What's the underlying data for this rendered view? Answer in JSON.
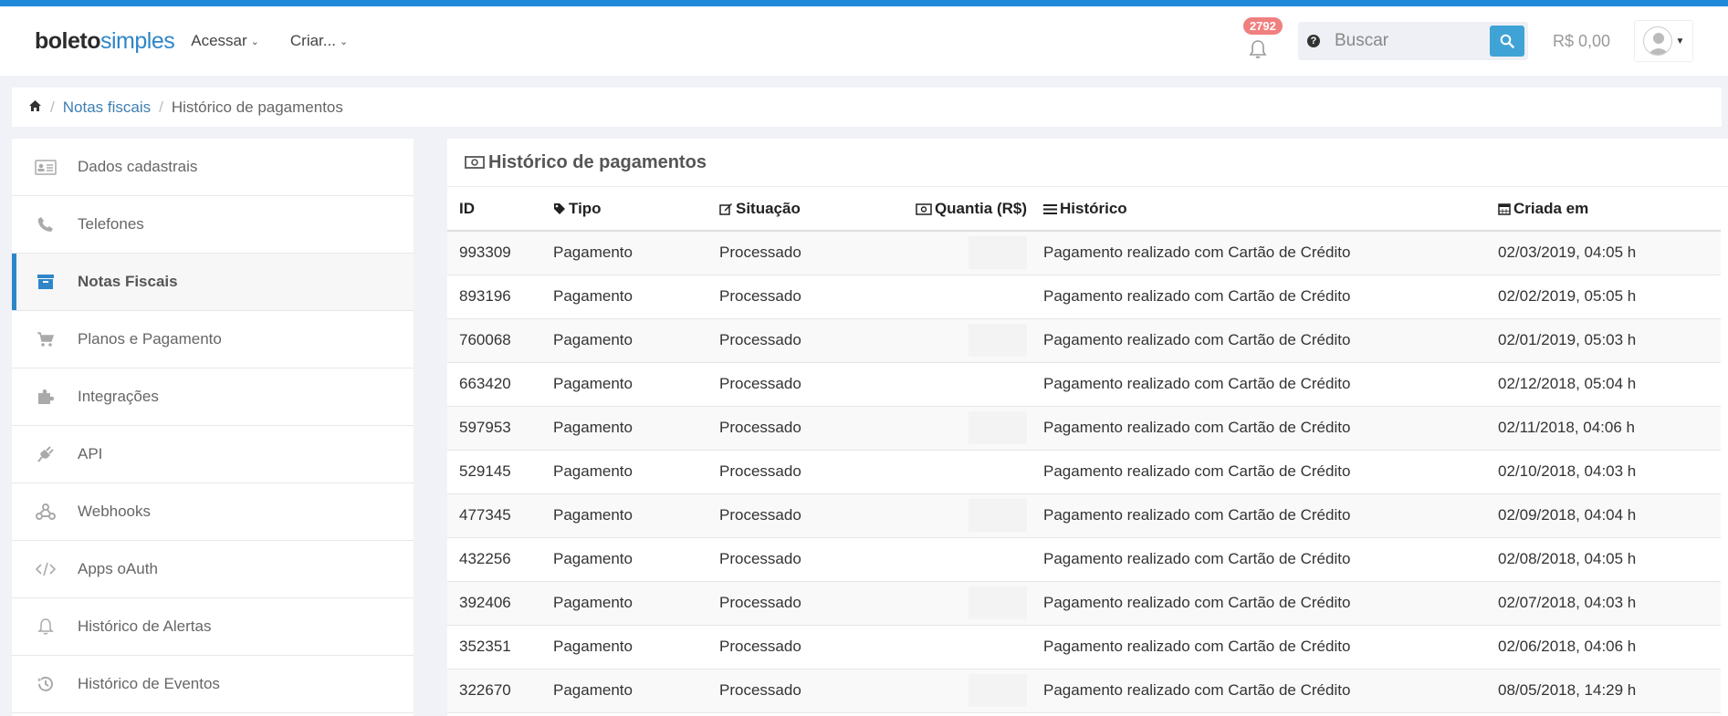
{
  "logo": {
    "part1": "boleto",
    "part2": "simples"
  },
  "nav": {
    "acessar": "Acessar",
    "criar": "Criar..."
  },
  "notifications": {
    "count": "2792"
  },
  "search": {
    "placeholder": "Buscar"
  },
  "balance": "R$ 0,00",
  "breadcrumb": {
    "notas": "Notas fiscais",
    "current": "Histórico de pagamentos"
  },
  "sidebar": {
    "items": [
      {
        "label": "Dados cadastrais",
        "icon": "id-card-icon"
      },
      {
        "label": "Telefones",
        "icon": "phone-icon"
      },
      {
        "label": "Notas Fiscais",
        "icon": "archive-icon"
      },
      {
        "label": "Planos e Pagamento",
        "icon": "cart-icon"
      },
      {
        "label": "Integrações",
        "icon": "puzzle-icon"
      },
      {
        "label": "API",
        "icon": "plug-icon"
      },
      {
        "label": "Webhooks",
        "icon": "webhook-icon"
      },
      {
        "label": "Apps oAuth",
        "icon": "code-icon"
      },
      {
        "label": "Histórico de Alertas",
        "icon": "bell-icon"
      },
      {
        "label": "Histórico de Eventos",
        "icon": "history-icon"
      }
    ]
  },
  "panel": {
    "title": "Histórico de pagamentos"
  },
  "table": {
    "headers": {
      "id": "ID",
      "tipo": "Tipo",
      "situacao": "Situação",
      "quantia": "Quantia (R$)",
      "historico": "Histórico",
      "criada": "Criada em"
    },
    "rows": [
      {
        "id": "993309",
        "tipo": "Pagamento",
        "situacao": "Processado",
        "historico": "Pagamento realizado com Cartão de Crédito",
        "criada": "02/03/2019, 04:05 h"
      },
      {
        "id": "893196",
        "tipo": "Pagamento",
        "situacao": "Processado",
        "historico": "Pagamento realizado com Cartão de Crédito",
        "criada": "02/02/2019, 05:05 h"
      },
      {
        "id": "760068",
        "tipo": "Pagamento",
        "situacao": "Processado",
        "historico": "Pagamento realizado com Cartão de Crédito",
        "criada": "02/01/2019, 05:03 h"
      },
      {
        "id": "663420",
        "tipo": "Pagamento",
        "situacao": "Processado",
        "historico": "Pagamento realizado com Cartão de Crédito",
        "criada": "02/12/2018, 05:04 h"
      },
      {
        "id": "597953",
        "tipo": "Pagamento",
        "situacao": "Processado",
        "historico": "Pagamento realizado com Cartão de Crédito",
        "criada": "02/11/2018, 04:06 h"
      },
      {
        "id": "529145",
        "tipo": "Pagamento",
        "situacao": "Processado",
        "historico": "Pagamento realizado com Cartão de Crédito",
        "criada": "02/10/2018, 04:03 h"
      },
      {
        "id": "477345",
        "tipo": "Pagamento",
        "situacao": "Processado",
        "historico": "Pagamento realizado com Cartão de Crédito",
        "criada": "02/09/2018, 04:04 h"
      },
      {
        "id": "432256",
        "tipo": "Pagamento",
        "situacao": "Processado",
        "historico": "Pagamento realizado com Cartão de Crédito",
        "criada": "02/08/2018, 04:05 h"
      },
      {
        "id": "392406",
        "tipo": "Pagamento",
        "situacao": "Processado",
        "historico": "Pagamento realizado com Cartão de Crédito",
        "criada": "02/07/2018, 04:03 h"
      },
      {
        "id": "352351",
        "tipo": "Pagamento",
        "situacao": "Processado",
        "historico": "Pagamento realizado com Cartão de Crédito",
        "criada": "02/06/2018, 04:06 h"
      },
      {
        "id": "322670",
        "tipo": "Pagamento",
        "situacao": "Processado",
        "historico": "Pagamento realizado com Cartão de Crédito",
        "criada": "08/05/2018, 14:29 h"
      }
    ]
  }
}
